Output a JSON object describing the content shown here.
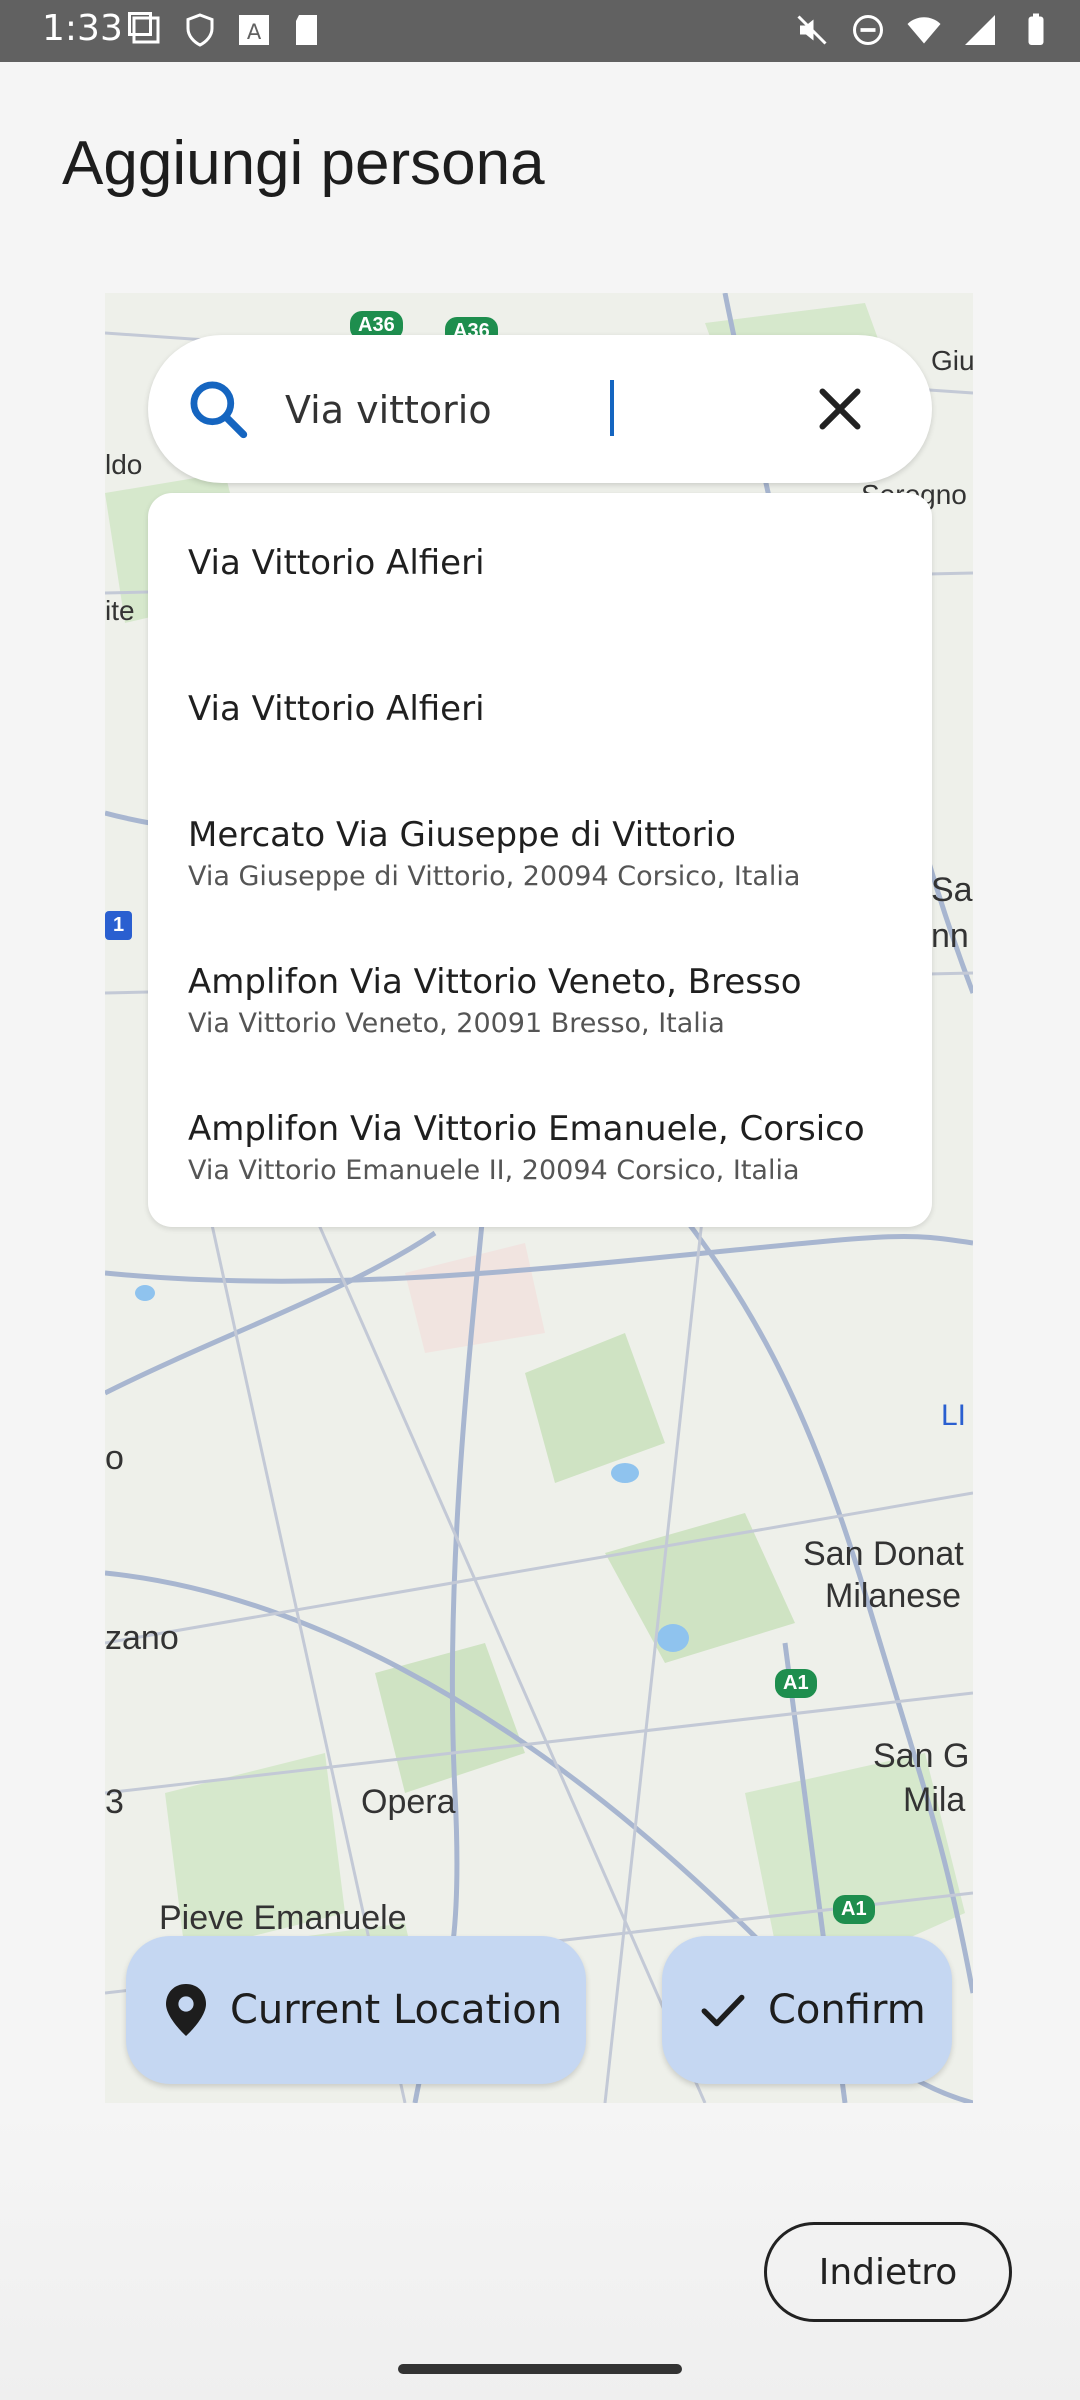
{
  "status_bar": {
    "time": "1:33",
    "left_icons": [
      "screenshot-icon",
      "shield-icon",
      "font-a-icon",
      "sd-card-icon"
    ],
    "right_icons": [
      "mute-icon",
      "dnd-icon",
      "wifi-icon",
      "signal-icon",
      "battery-icon"
    ]
  },
  "page": {
    "title": "Aggiungi persona"
  },
  "map": {
    "labels": [
      "Giu",
      "Seregno",
      "ldo",
      "ite",
      "Sa",
      "nn",
      "San Donat",
      "Milanese",
      "zano",
      "San G",
      "Mila",
      "Opera",
      "Pieve Emanuele",
      "o",
      "3",
      "LI"
    ],
    "route_shields": [
      "A36",
      "A36",
      "A1",
      "A1",
      "1"
    ]
  },
  "search": {
    "value": "Via vittorio",
    "placeholder": ""
  },
  "suggestions": [
    {
      "title": "Via Vittorio Alfieri",
      "subtitle": ""
    },
    {
      "title": "Via Vittorio Alfieri",
      "subtitle": ""
    },
    {
      "title": "Mercato Via Giuseppe di Vittorio",
      "subtitle": "Via Giuseppe di Vittorio, 20094 Corsico, Italia"
    },
    {
      "title": "Amplifon Via Vittorio Veneto, Bresso",
      "subtitle": "Via Vittorio Veneto, 20091 Bresso, Italia"
    },
    {
      "title": "Amplifon Via Vittorio Emanuele, Corsico",
      "subtitle": "Via Vittorio Emanuele II, 20094 Corsico, Italia"
    }
  ],
  "buttons": {
    "current_location": "Current Location",
    "confirm": "Confirm",
    "back": "Indietro"
  },
  "colors": {
    "accent": "#1565c0",
    "fab_bg": "#c5d7f2",
    "statusbar": "#616161",
    "map_bg": "#eef0ea"
  }
}
